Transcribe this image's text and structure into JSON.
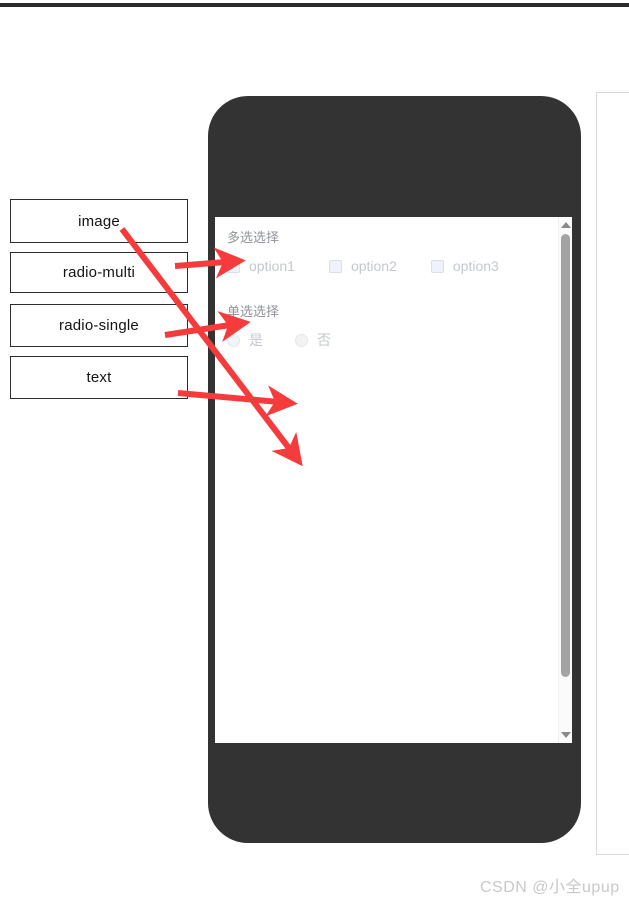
{
  "annotations": {
    "boxes": [
      {
        "label": "image"
      },
      {
        "label": "radio-multi"
      },
      {
        "label": "radio-single"
      },
      {
        "label": "text"
      }
    ],
    "arrow_color": "#f53b3b"
  },
  "phone": {
    "frame_color": "#333333",
    "screen_bg": "#ffffff"
  },
  "form": {
    "groups": [
      {
        "heading": "多选选择",
        "type": "checkbox",
        "options": [
          {
            "label": "option1",
            "checked": false
          },
          {
            "label": "option2",
            "checked": false
          },
          {
            "label": "option3",
            "checked": false
          }
        ]
      },
      {
        "heading": "单选选择",
        "type": "radio",
        "options": [
          {
            "label": "是",
            "checked": false
          },
          {
            "label": "否",
            "checked": false
          }
        ]
      }
    ]
  },
  "scrollbar": {
    "up_arrow": "scroll-up",
    "down_arrow": "scroll-down",
    "thumb_color": "#a3a3a3"
  },
  "watermark": {
    "text": "CSDN @小全upup"
  }
}
